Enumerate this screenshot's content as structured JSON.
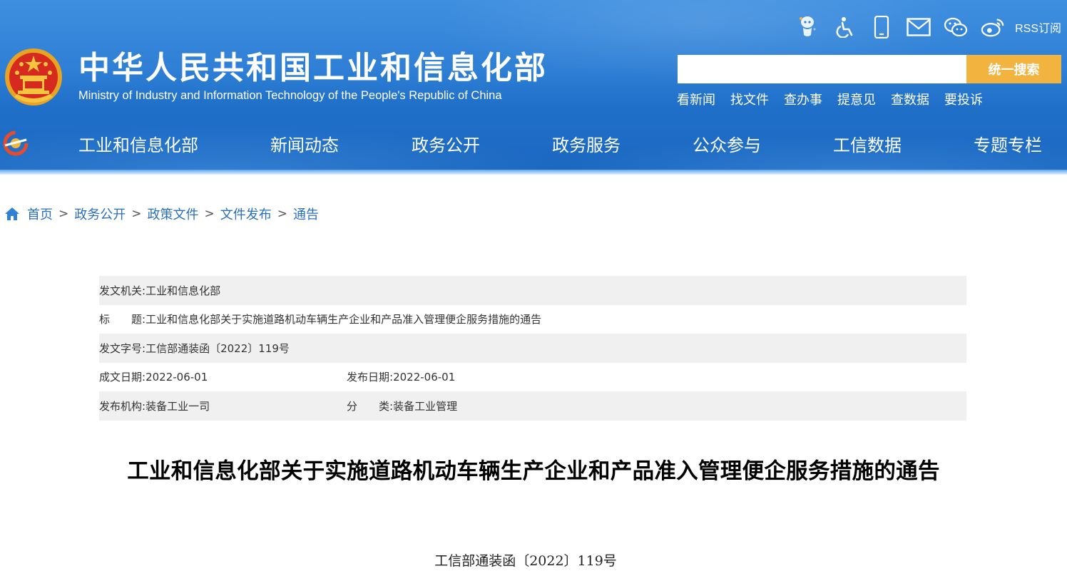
{
  "header": {
    "site_title": "中华人民共和国工业和信息化部",
    "site_subtitle": "Ministry of Industry and Information Technology of the People's Republic of China",
    "icons": [
      "ai-assistant-icon",
      "accessibility-icon",
      "mobile-icon",
      "mail-icon",
      "wechat-icon",
      "weibo-icon"
    ],
    "rss_label": "RSS订阅",
    "search": {
      "placeholder": "",
      "value": "",
      "button_label": "统一搜索"
    },
    "quick_links": [
      "看新闻",
      "找文件",
      "查办事",
      "提意见",
      "查数据",
      "要投诉"
    ]
  },
  "nav": {
    "items": [
      "工业和信息化部",
      "新闻动态",
      "政务公开",
      "政务服务",
      "公众参与",
      "工信数据",
      "专题专栏"
    ]
  },
  "breadcrumb": {
    "items": [
      "首页",
      "政务公开",
      "政策文件",
      "文件发布",
      "通告"
    ],
    "separator": ">"
  },
  "meta": {
    "issuer_label": "发文机关:",
    "issuer": "工业和信息化部",
    "title_label": "标　　题:",
    "title": "工业和信息化部关于实施道路机动车辆生产企业和产品准入管理便企服务措施的通告",
    "doc_no_label": "发文字号:",
    "doc_no": "工信部通装函〔2022〕119号",
    "written_date_label": "成文日期:",
    "written_date": "2022-06-01",
    "publish_date_label": "发布日期:",
    "publish_date": "2022-06-01",
    "org_label": "发布机构:",
    "org": "装备工业一司",
    "category_label": "分　　类:",
    "category": "装备工业管理"
  },
  "article": {
    "title": "工业和信息化部关于实施道路机动车辆生产企业和产品准入管理便企服务措施的通告",
    "doc_number": "工信部通装函〔2022〕119号"
  },
  "colors": {
    "header_blue": "#2f80d6",
    "search_button": "#f2b43f",
    "breadcrumb_link": "#2a6fbf",
    "meta_row_alt": "#f0f0f0"
  }
}
